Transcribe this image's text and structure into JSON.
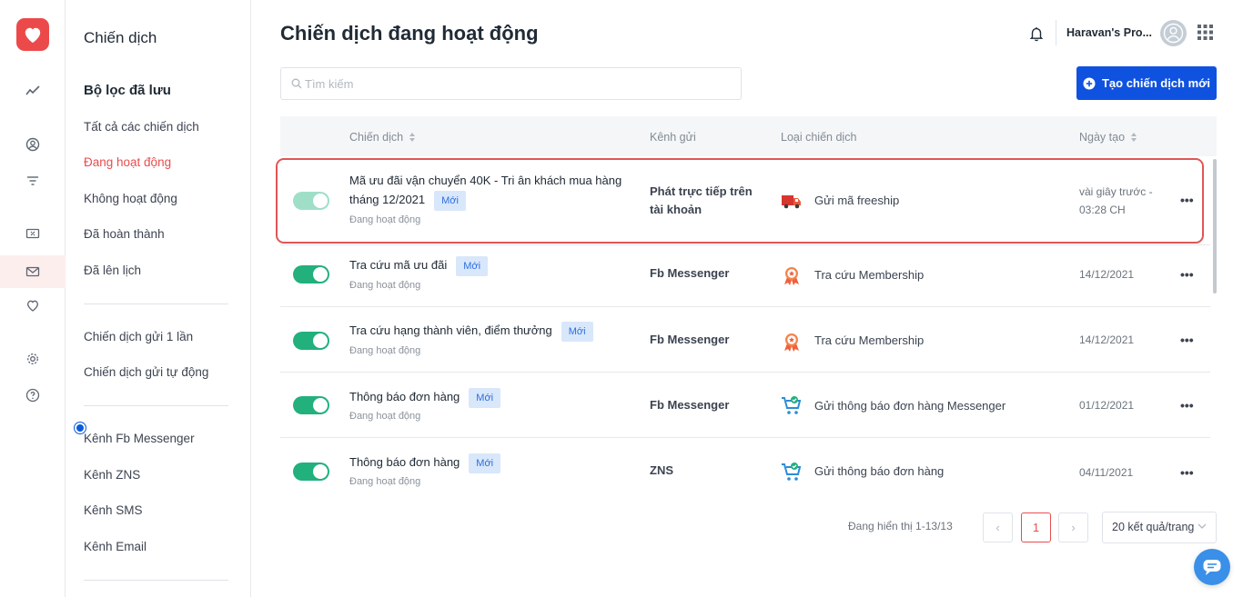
{
  "rail": {
    "items": [
      "analytics-icon",
      "user-circle-icon",
      "filter-icon",
      "voucher-icon",
      "mail-icon",
      "heart-icon",
      "settings-icon",
      "help-icon"
    ]
  },
  "sidebar": {
    "title": "Chiến dịch",
    "heading": "Bộ lọc đã lưu",
    "filters": [
      "Tất cả các chiến dịch",
      "Đang hoạt động",
      "Không hoạt động",
      "Đã hoàn thành",
      "Đã lên lịch"
    ],
    "sends": [
      "Chiến dịch gửi 1 lần",
      "Chiến dịch gửi tự động"
    ],
    "channels": [
      "Kênh Fb Messenger",
      "Kênh ZNS",
      "Kênh SMS",
      "Kênh Email"
    ]
  },
  "header": {
    "title": "Chiến dịch đang hoạt động",
    "store_name": "Haravan's Pro..."
  },
  "search": {
    "placeholder": "Tìm kiếm"
  },
  "create_button": {
    "label": "Tạo chiến dịch mới"
  },
  "table": {
    "columns": [
      "Chiến dịch",
      "Kênh gửi",
      "Loại chiến dịch",
      "Ngày tạo"
    ],
    "rows": [
      {
        "name_line1": "Mã ưu đãi vận chuyển 40K - Tri ân khách mua hàng",
        "name_line2": "tháng 12/2021",
        "badge": "Mới",
        "status": "Đang hoạt động",
        "channel_line1": "Phát trực tiếp trên",
        "channel_line2": "tài khoản",
        "type_icon": "truck-icon",
        "type": "Gửi mã freeship",
        "date_line1": "vài giây trước -",
        "date_line2": "03:28 CH",
        "toggle_on": true
      },
      {
        "name": "Tra cứu mã ưu đãi",
        "badge": "Mới",
        "status": "Đang hoạt động",
        "channel": "Fb Messenger",
        "type_icon": "medal-icon",
        "type": "Tra cứu Membership",
        "date": "14/12/2021",
        "toggle_on": true
      },
      {
        "name": "Tra cứu hạng thành viên, điểm thưởng",
        "badge": "Mới",
        "status": "Đang hoạt động",
        "channel": "Fb Messenger",
        "type_icon": "medal-icon",
        "type": "Tra cứu Membership",
        "date": "14/12/2021",
        "toggle_on": true
      },
      {
        "name": "Thông báo đơn hàng",
        "badge": "Mới",
        "status": "Đang hoạt động",
        "channel": "Fb Messenger",
        "type_icon": "cart-check-icon",
        "type": "Gửi thông báo đơn hàng Messenger",
        "date": "01/12/2021",
        "toggle_on": true
      },
      {
        "name": "Thông báo đơn hàng",
        "badge": "Mới",
        "status": "Đang hoạt động",
        "channel": "ZNS",
        "type_icon": "cart-check-icon",
        "type": "Gửi thông báo đơn hàng",
        "date": "04/11/2021",
        "toggle_on": true
      }
    ]
  },
  "pagination": {
    "info": "Đang hiển thị 1-13/13",
    "prev": "‹",
    "current": "1",
    "next": "›",
    "per_page": "20 kết quả/trang"
  },
  "colors": {
    "accent_red": "#e84d4d",
    "primary_blue": "#0f52e0",
    "toggle_green": "#22b07d"
  }
}
